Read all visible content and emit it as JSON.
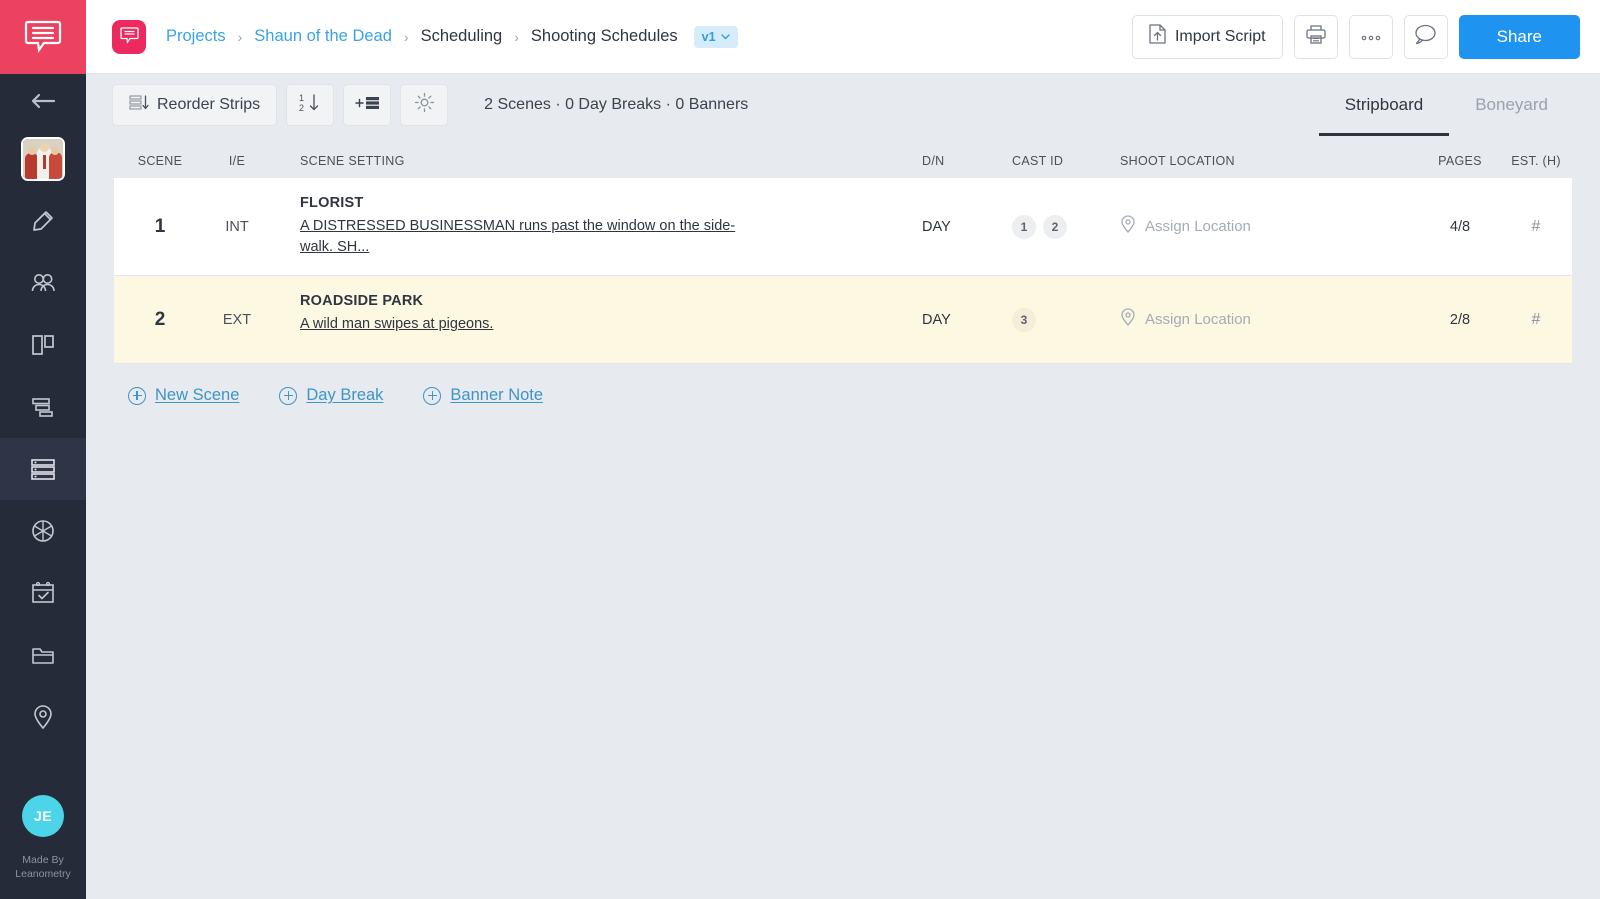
{
  "brand": {
    "logo_icon": "speech-bubble-logo",
    "logo_color": "#ec4260",
    "accent_blue": "#1f93f0",
    "link_blue": "#3aa3e3",
    "sidebar_bg": "#252b38",
    "highlight_row": "#fcf8e1"
  },
  "sidebar": {
    "back_icon": "arrow-left-icon",
    "project_thumbnail": "project-thumbnail",
    "items": [
      {
        "icon": "pencil-icon",
        "name": "script",
        "active": false
      },
      {
        "icon": "users-icon",
        "name": "cast",
        "active": false
      },
      {
        "icon": "breakdown-icon",
        "name": "breakdown",
        "active": false
      },
      {
        "icon": "gantt-icon",
        "name": "shot-list",
        "active": false
      },
      {
        "icon": "stripboard-icon",
        "name": "scheduling",
        "active": true
      },
      {
        "icon": "aperture-icon",
        "name": "storyboard",
        "active": false
      },
      {
        "icon": "calendar-check-icon",
        "name": "calendar",
        "active": false
      },
      {
        "icon": "folder-icon",
        "name": "files",
        "active": false
      },
      {
        "icon": "map-pin-icon",
        "name": "locations",
        "active": false
      }
    ],
    "user_initials": "JE",
    "made_by_line1": "Made By",
    "made_by_line2": "Leanometry"
  },
  "topbar": {
    "project_badge_icon": "speech-bubble-icon",
    "breadcrumbs": [
      {
        "label": "Projects",
        "current": false
      },
      {
        "label": "Shaun of the Dead",
        "current": false
      },
      {
        "label": "Scheduling",
        "current": true
      },
      {
        "label": "Shooting Schedules",
        "current": true
      }
    ],
    "separator": "›",
    "version_badge": "v1",
    "version_caret": "⌄",
    "import_script_label": "Import Script",
    "import_script_icon": "file-upload-icon",
    "print_icon": "printer-icon",
    "more_icon": "ellipsis-icon",
    "comments_icon": "comment-bubble-icon",
    "share_label": "Share"
  },
  "toolbar": {
    "reorder_label": "Reorder Strips",
    "reorder_icon": "reorder-list-icon",
    "sort_icon": "sort-numeric-icon",
    "add_strip_icon": "add-strip-icon",
    "settings_icon": "gear-icon",
    "counts": "2 Scenes · 0 Day Breaks · 0 Banners",
    "tabs": [
      {
        "label": "Stripboard",
        "active": true
      },
      {
        "label": "Boneyard",
        "active": false
      }
    ]
  },
  "table": {
    "headers": {
      "scene": "SCENE",
      "ie": "I/E",
      "setting": "SCENE SETTING",
      "dn": "D/N",
      "cast": "CAST ID",
      "location": "SHOOT LOCATION",
      "pages": "PAGES",
      "est": "EST. (H)"
    },
    "location_placeholder": "Assign Location",
    "location_icon": "map-pin-icon",
    "rows": [
      {
        "scene": "1",
        "ie": "INT",
        "setting_title": "FLORIST",
        "setting_desc": "A DISTRESSED BUSINESSMAN runs past the window on the side-walk. SH...",
        "dn": "DAY",
        "cast": [
          "1",
          "2"
        ],
        "location": "Assign Location",
        "pages": "4/8",
        "est": "#",
        "highlight": false
      },
      {
        "scene": "2",
        "ie": "EXT",
        "setting_title": "ROADSIDE PARK",
        "setting_desc": "A wild man swipes at pigeons.",
        "dn": "DAY",
        "cast": [
          "3"
        ],
        "location": "Assign Location",
        "pages": "2/8",
        "est": "#",
        "highlight": true
      }
    ]
  },
  "actions": [
    {
      "label": "New Scene",
      "icon": "plus-circle-icon"
    },
    {
      "label": "Day Break",
      "icon": "plus-circle-icon"
    },
    {
      "label": "Banner Note",
      "icon": "plus-circle-icon"
    }
  ]
}
